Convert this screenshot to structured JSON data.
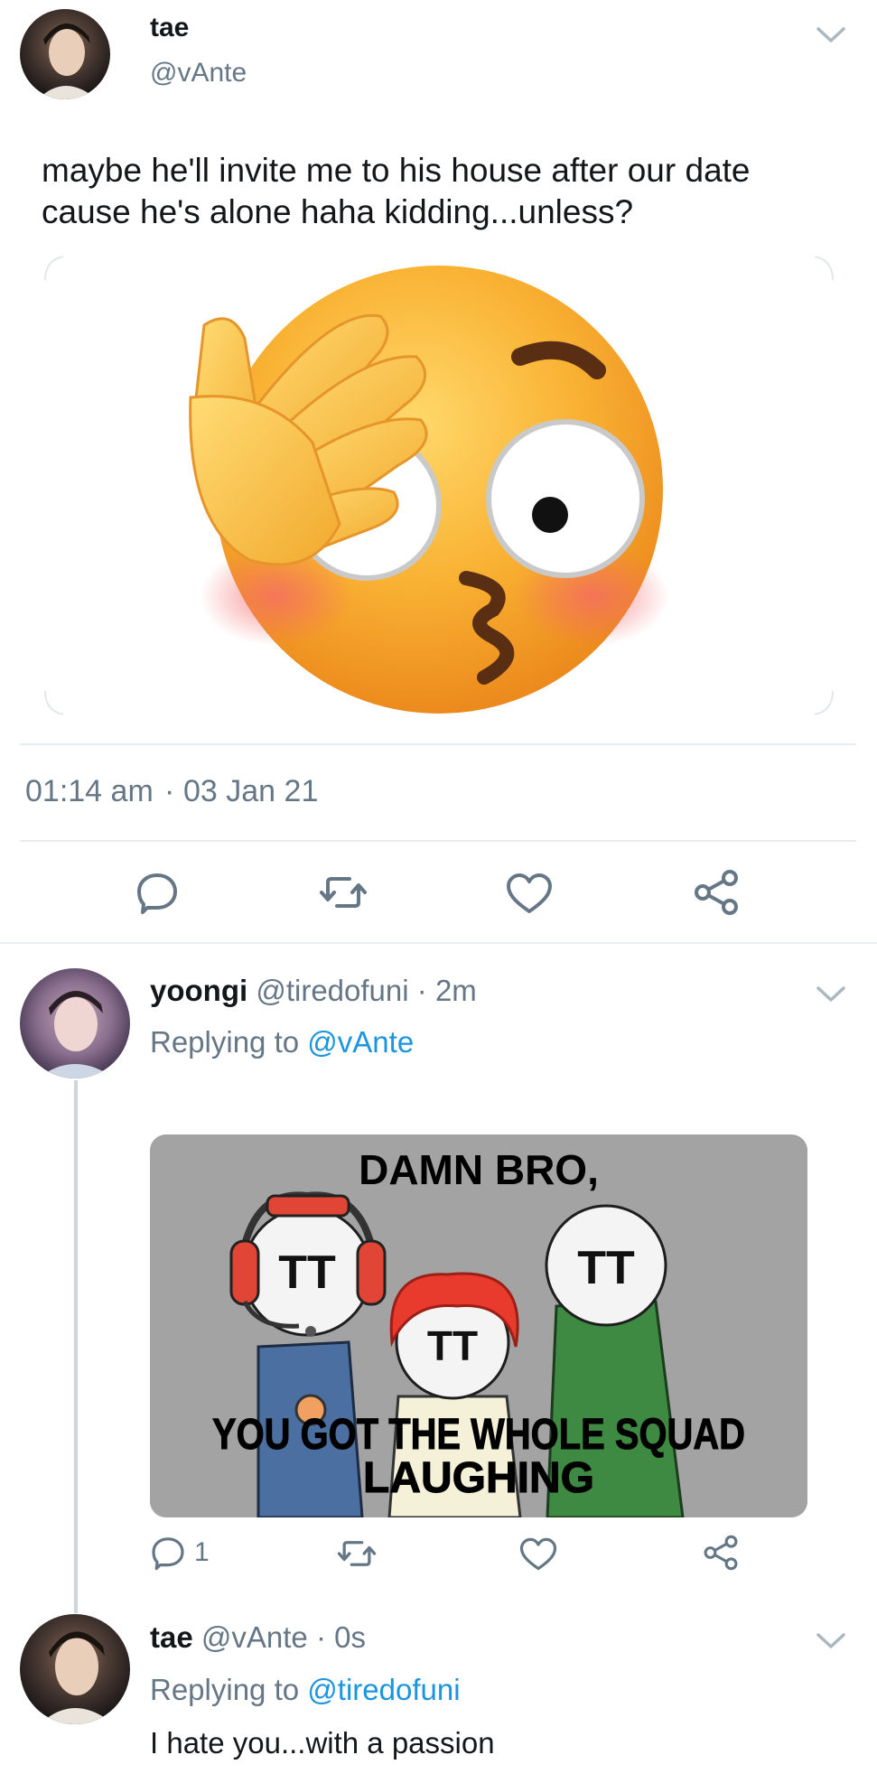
{
  "main_tweet": {
    "display_name": "tae",
    "handle": "@vAnte",
    "text_line1": "maybe he'll invite me to his house after our date",
    "text_line2": "cause he's alone haha kidding...unless?",
    "image_icon": "face-with-hand-over-eye-emoji",
    "time": "01:14 am",
    "separator": "·",
    "date": "03 Jan 21",
    "actions": [
      "reply-icon",
      "retweet-icon",
      "like-icon",
      "share-icon"
    ]
  },
  "reply1": {
    "display_name": "yoongi",
    "handle": "@tiredofuni",
    "separator": "·",
    "age": "2m",
    "replying_prefix": "Replying to",
    "replying_to": "@vAnte",
    "meme_top": "DAMN BRO,",
    "meme_bottom_line1": "YOU GOT THE WHOLE SQUAD",
    "meme_bottom_line2": "LAUGHING",
    "face_text": "TT",
    "reply_count": "1"
  },
  "reply2": {
    "display_name": "tae",
    "handle": "@vAnte",
    "separator": "·",
    "age": "0s",
    "replying_prefix": "Replying to",
    "replying_to": "@tiredofuni",
    "text": "I hate you...with a passion"
  },
  "colors": {
    "text": "#14171a",
    "grey": "#657786",
    "link": "#1b95e0",
    "divider": "#e6ecf0"
  }
}
